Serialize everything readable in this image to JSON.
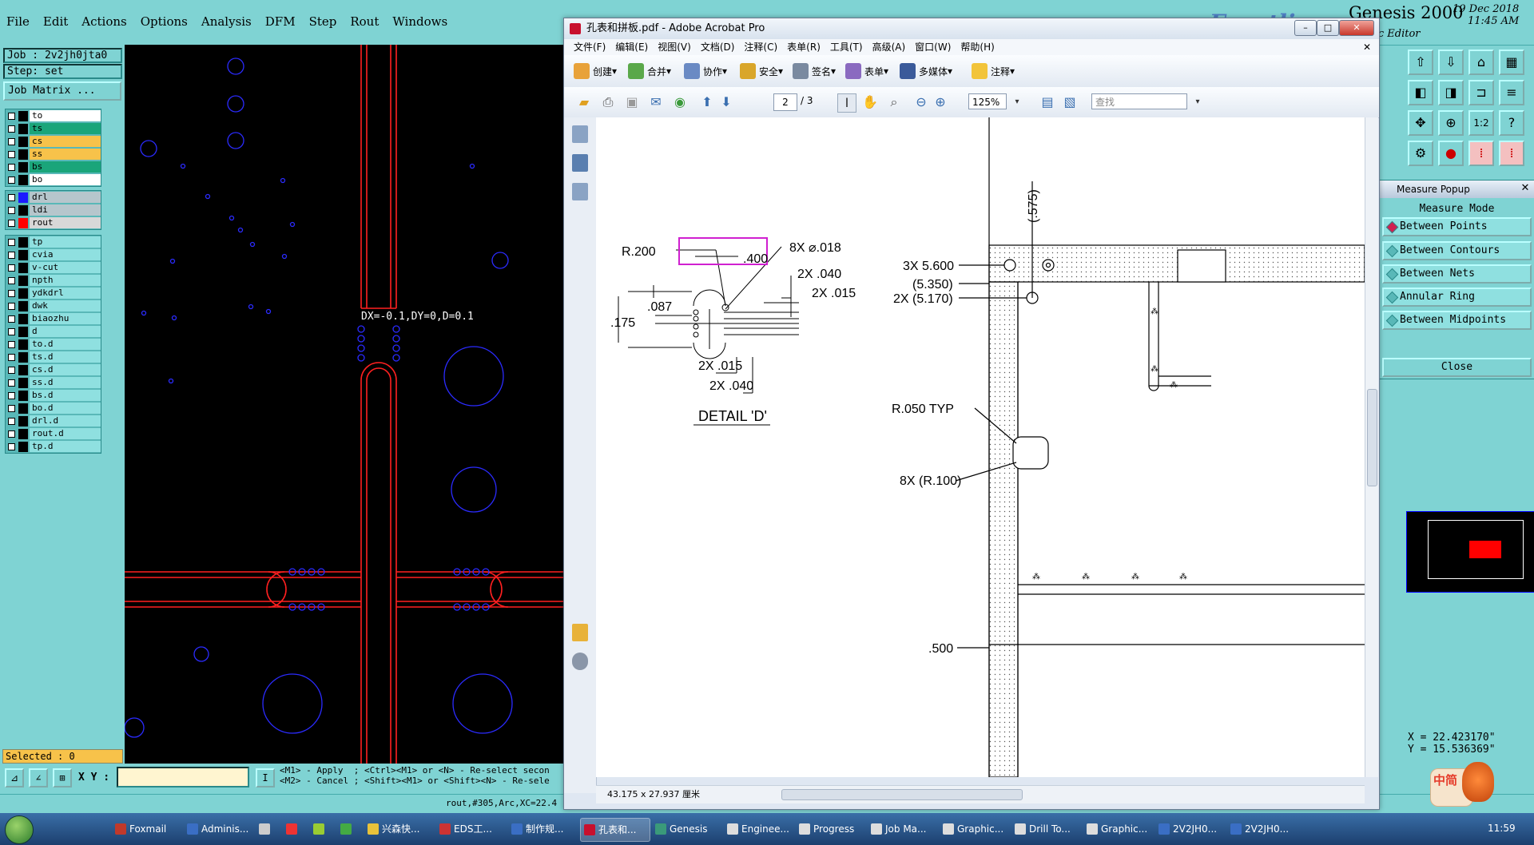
{
  "genesis": {
    "menu": [
      "File",
      "Edit",
      "Actions",
      "Options",
      "Analysis",
      "DFM",
      "Step",
      "Rout",
      "Windows"
    ],
    "brand": {
      "logo_text": "Frontline",
      "title": "Genesis 2000",
      "date": "19 Dec 2018",
      "time": "11:45 AM",
      "subtitle": "phic Editor"
    },
    "job_label": "Job : 2v2jh0jta0",
    "step_label": "Step: set",
    "job_matrix_button": "Job Matrix ...",
    "selected": "Selected : 0",
    "measure_readout": "DX=-0.1,DY=0,D=0.1",
    "xy_label": "X Y :",
    "xy_value": "",
    "mouse_help_line1": "<M1> - Apply  ; <Ctrl><M1> or <N> - Re-select secon",
    "mouse_help_line2": "<M2> - Cancel ; <Shift><M1> or <Shift><N> - Re-sele",
    "status_text": "rout,#305,Arc,XC=22.4",
    "coords": {
      "x": "X = 22.423170\"",
      "y": "Y = 15.536369\""
    },
    "layer_groups": [
      {
        "layers": [
          {
            "name": "to",
            "color": "#ffffff",
            "swatch": "#000000"
          },
          {
            "name": "ts",
            "color": "#1aa57a",
            "swatch": "#000000"
          },
          {
            "name": "cs",
            "color": "#f7c24a",
            "swatch": "#000000"
          },
          {
            "name": "ss",
            "color": "#f7c24a",
            "swatch": "#000000"
          },
          {
            "name": "bs",
            "color": "#1aa57a",
            "swatch": "#000000"
          },
          {
            "name": "bo",
            "color": "#ffffff",
            "swatch": "#000000"
          }
        ]
      },
      {
        "layers": [
          {
            "name": "drl",
            "color": "#b6c6cc",
            "swatch": "#1b1bff"
          },
          {
            "name": "ldi",
            "color": "#b6c6cc",
            "swatch": "#000000"
          },
          {
            "name": "rout",
            "color": "#d8d8d8",
            "swatch": "#ff0000"
          }
        ]
      },
      {
        "layers": [
          {
            "name": "tp",
            "color": "#8fe0e0",
            "swatch": "#000000"
          },
          {
            "name": "cvia",
            "color": "#8fe0e0",
            "swatch": "#000000"
          },
          {
            "name": "v-cut",
            "color": "#8fe0e0",
            "swatch": "#000000"
          },
          {
            "name": "npth",
            "color": "#8fe0e0",
            "swatch": "#000000"
          },
          {
            "name": "ydkdrl",
            "color": "#8fe0e0",
            "swatch": "#000000"
          },
          {
            "name": "dwk",
            "color": "#8fe0e0",
            "swatch": "#000000"
          },
          {
            "name": "biaozhu",
            "color": "#8fe0e0",
            "swatch": "#000000"
          },
          {
            "name": "d",
            "color": "#8fe0e0",
            "swatch": "#000000"
          },
          {
            "name": "to.d",
            "color": "#8fe0e0",
            "swatch": "#000000"
          },
          {
            "name": "ts.d",
            "color": "#8fe0e0",
            "swatch": "#000000"
          },
          {
            "name": "cs.d",
            "color": "#8fe0e0",
            "swatch": "#000000"
          },
          {
            "name": "ss.d",
            "color": "#8fe0e0",
            "swatch": "#000000"
          },
          {
            "name": "bs.d",
            "color": "#8fe0e0",
            "swatch": "#000000"
          },
          {
            "name": "bo.d",
            "color": "#8fe0e0",
            "swatch": "#000000"
          },
          {
            "name": "drl.d",
            "color": "#8fe0e0",
            "swatch": "#000000"
          },
          {
            "name": "rout.d",
            "color": "#8fe0e0",
            "swatch": "#000000"
          },
          {
            "name": "tp.d",
            "color": "#8fe0e0",
            "swatch": "#000000"
          }
        ]
      }
    ],
    "measure_popup": {
      "title": "Measure Popup",
      "header": "Measure Mode",
      "options": [
        "Between Points",
        "Between Contours",
        "Between Nets",
        "Annular Ring",
        "Between Midpoints"
      ],
      "selected_option": "Between Points",
      "close_label": "Close"
    }
  },
  "acrobat": {
    "title": "孔表和拼板.pdf - Adobe Acrobat Pro",
    "menu": [
      "文件(F)",
      "编辑(E)",
      "视图(V)",
      "文档(D)",
      "注释(C)",
      "表单(R)",
      "工具(T)",
      "高级(A)",
      "窗口(W)",
      "帮助(H)"
    ],
    "tasks": [
      "创建",
      "合并",
      "协作",
      "安全",
      "签名",
      "表单",
      "多媒体",
      "注释"
    ],
    "page_current": "2",
    "page_total": "/ 3",
    "zoom": "125%",
    "search_placeholder": "查找",
    "page_size": "43.175 x 27.937 厘米",
    "drawing": {
      "r200": "R.200",
      "d400": ".400",
      "hole8x": "8X ⌀.018",
      "d2x040a": "2X .040",
      "d2x015a": "2X .015",
      "d087": ".087",
      "d175": ".175",
      "d2x015b": "2X .015",
      "d2x040b": "2X .040",
      "detail": "DETAIL 'D'",
      "d575": "(.575)",
      "d3x5600": "3X 5.600",
      "d5350": "(5.350)",
      "d2x5170": "2X (5.170)",
      "r050": "R.050 TYP",
      "r8x100": "8X (R.100)",
      "d500": ".500"
    }
  },
  "taskbar": {
    "items": [
      "Foxmail",
      "Adminis...",
      "",
      "",
      "",
      "",
      "兴森快...",
      "EDS工...",
      "制作规...",
      "孔表和...",
      "Genesis",
      "Enginee...",
      "Progress",
      "Job Ma...",
      "Graphic...",
      "Drill To...",
      "Graphic...",
      "2V2JH0...",
      "2V2JH0..."
    ],
    "active": "孔表和...",
    "clock": "11:59"
  },
  "ime": {
    "label": "中简"
  }
}
